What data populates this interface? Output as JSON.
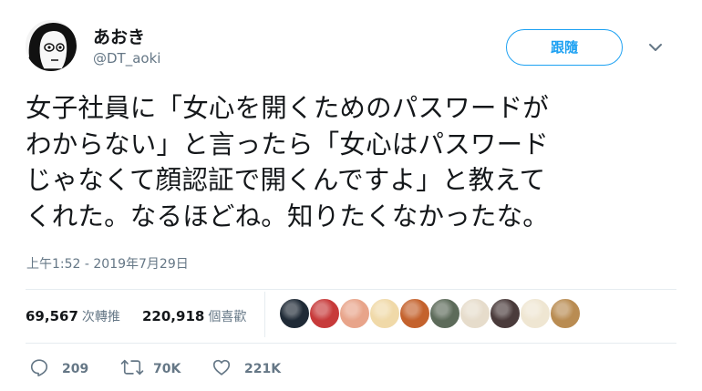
{
  "author": {
    "display_name": "あおき",
    "handle": "@DT_aoki"
  },
  "follow_label": "跟隨",
  "tweet": {
    "text": "女子社員に「女心を開くためのパスワードが\nわからない」と言ったら「女心はパスワード\nじゃなくて顔認証で開くんですよ」と教えて\nくれた。なるほどね。知りたくなかったな。",
    "timestamp": "上午1:52 - 2019年7月29日"
  },
  "stats": {
    "retweets_count": "69,567",
    "retweets_label": "次轉推",
    "likes_count": "220,918",
    "likes_label": "個喜歡"
  },
  "likers": [
    {
      "name": "liker-avatar-1",
      "color": "#1f2a36"
    },
    {
      "name": "liker-avatar-2",
      "color": "#c73a3a"
    },
    {
      "name": "liker-avatar-3",
      "color": "#e8a48a"
    },
    {
      "name": "liker-avatar-4",
      "color": "#f0d9a8"
    },
    {
      "name": "liker-avatar-5",
      "color": "#c4622d"
    },
    {
      "name": "liker-avatar-6",
      "color": "#5d6b5a"
    },
    {
      "name": "liker-avatar-7",
      "color": "#e6dccb"
    },
    {
      "name": "liker-avatar-8",
      "color": "#4a3b3b"
    },
    {
      "name": "liker-avatar-9",
      "color": "#efe6d2"
    },
    {
      "name": "liker-avatar-10",
      "color": "#b98c52"
    }
  ],
  "actions": {
    "replies": "209",
    "retweets": "70K",
    "likes": "221K"
  },
  "colors": {
    "accent": "#1da1f2",
    "text": "#14171a",
    "muted": "#657786",
    "divider": "#e6ecf0"
  }
}
